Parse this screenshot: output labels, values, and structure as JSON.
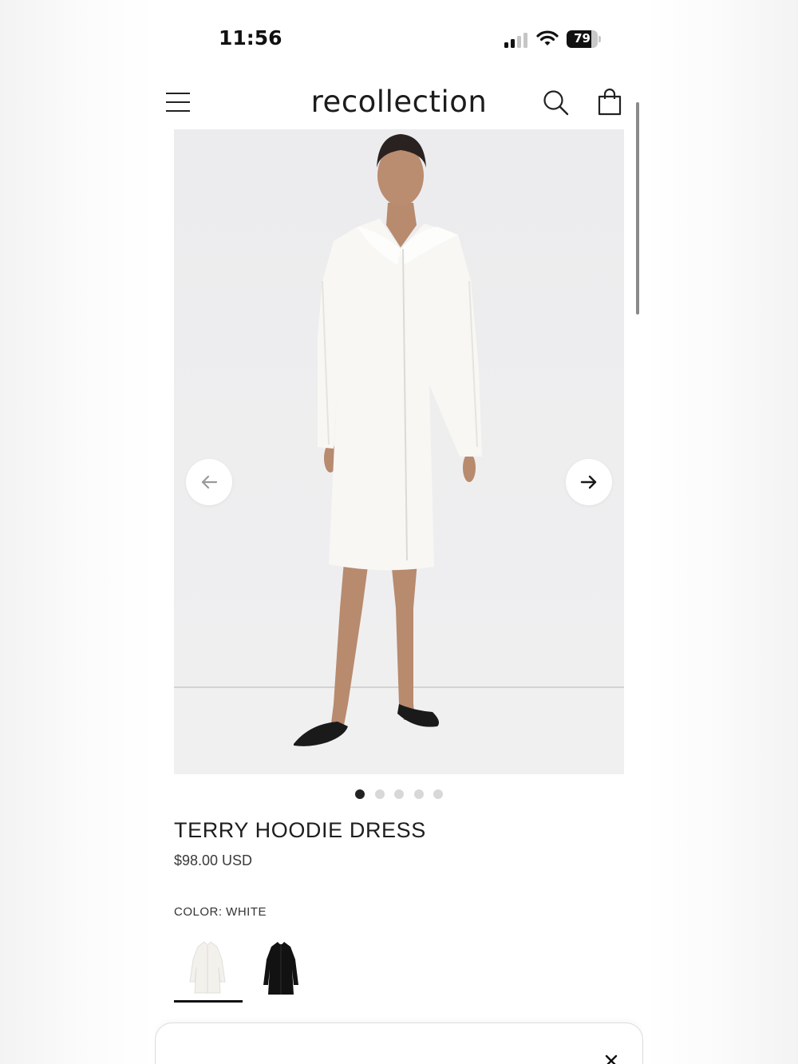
{
  "status_bar": {
    "time": "11:56",
    "battery": "79",
    "battery_level": 0.79
  },
  "header": {
    "logo": "recollection",
    "icons": [
      "hamburger-menu-icon",
      "search-icon",
      "shopping-bag-icon"
    ]
  },
  "gallery": {
    "image_count": 5,
    "active_index": 0,
    "prev_icon": "arrow-left-icon",
    "next_icon": "arrow-right-icon"
  },
  "product": {
    "title": "TERRY HOODIE DRESS",
    "price": "$98.00 USD",
    "color_label": "COLOR: WHITE",
    "swatches": [
      {
        "color": "#f2f0ea",
        "selected": true
      },
      {
        "color": "#111111",
        "selected": false
      }
    ]
  },
  "drawer": {
    "close_icon": "close-icon"
  }
}
